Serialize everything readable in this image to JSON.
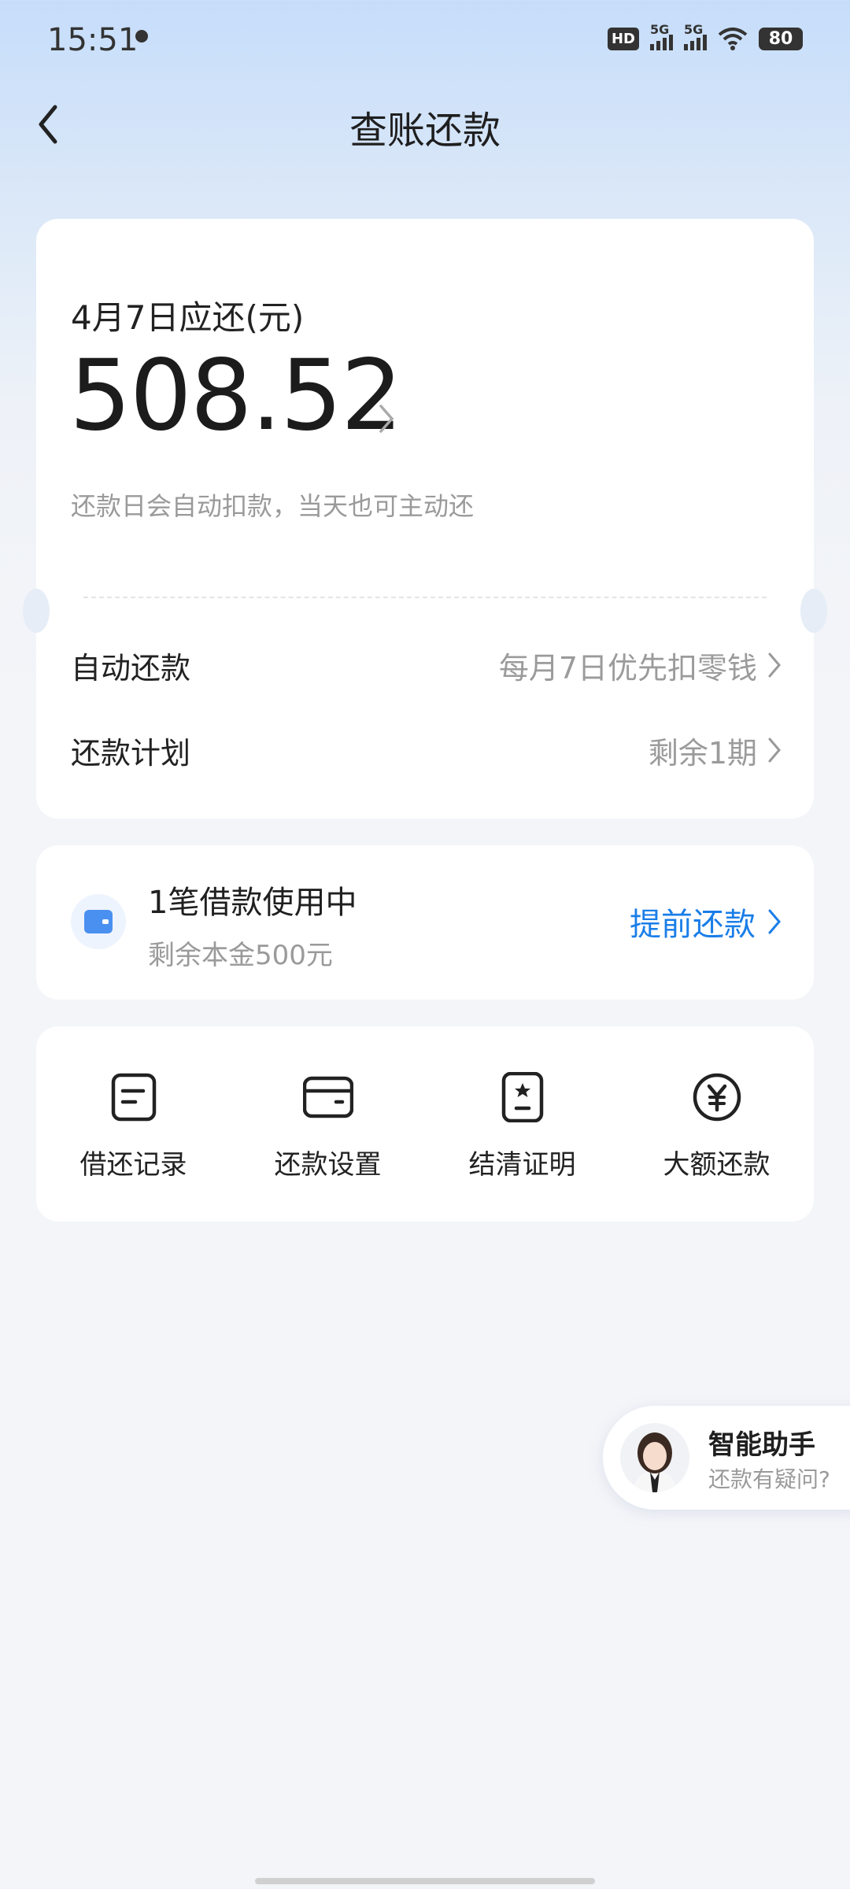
{
  "status_bar": {
    "time": "15:51",
    "network_1": "5G",
    "network_2": "5G",
    "hd_label": "HD",
    "battery": "80"
  },
  "header": {
    "title": "查账还款"
  },
  "bill": {
    "due_label": "4月7日应还(元)",
    "amount": "508.52",
    "hint": "还款日会自动扣款，当天也可主动还",
    "auto_repay": {
      "label": "自动还款",
      "value": "每月7日优先扣零钱"
    },
    "plan": {
      "label": "还款计划",
      "value": "剩余1期"
    }
  },
  "loan": {
    "title": "1笔借款使用中",
    "subtitle": "剩余本金500元",
    "action": "提前还款"
  },
  "tools": [
    {
      "label": "借还记录",
      "icon": "record-icon"
    },
    {
      "label": "还款设置",
      "icon": "card-icon"
    },
    {
      "label": "结清证明",
      "icon": "certificate-icon"
    },
    {
      "label": "大额还款",
      "icon": "yuan-icon"
    }
  ],
  "assistant": {
    "title": "智能助手",
    "subtitle": "还款有疑问?"
  },
  "colors": {
    "accent": "#1a7ee8",
    "wallet": "#4a90f0",
    "background": "#f4f5f9"
  }
}
